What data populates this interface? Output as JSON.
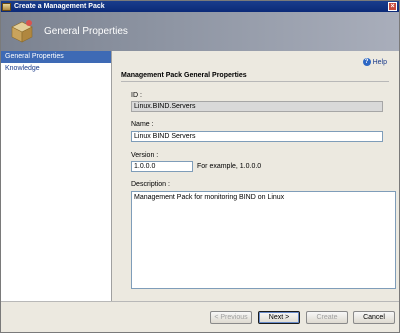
{
  "window": {
    "title": "Create a Management Pack"
  },
  "header": {
    "title": "General Properties"
  },
  "nav": {
    "items": [
      {
        "label": "General Properties",
        "active": true
      },
      {
        "label": "Knowledge",
        "active": false
      }
    ]
  },
  "help": {
    "label": "Help"
  },
  "form": {
    "section_title": "Management Pack General Properties",
    "id_label": "ID :",
    "id_value": "Linux.BIND.Servers",
    "name_label": "Name :",
    "name_value": "Linux BIND Servers",
    "version_label": "Version :",
    "version_value": "1.0.0.0",
    "version_example": "For example, 1.0.0.0",
    "description_label": "Description :",
    "description_value": "Management Pack for monitoring BIND on Linux"
  },
  "buttons": {
    "previous": "< Previous",
    "next": "Next >",
    "create": "Create",
    "cancel": "Cancel"
  }
}
